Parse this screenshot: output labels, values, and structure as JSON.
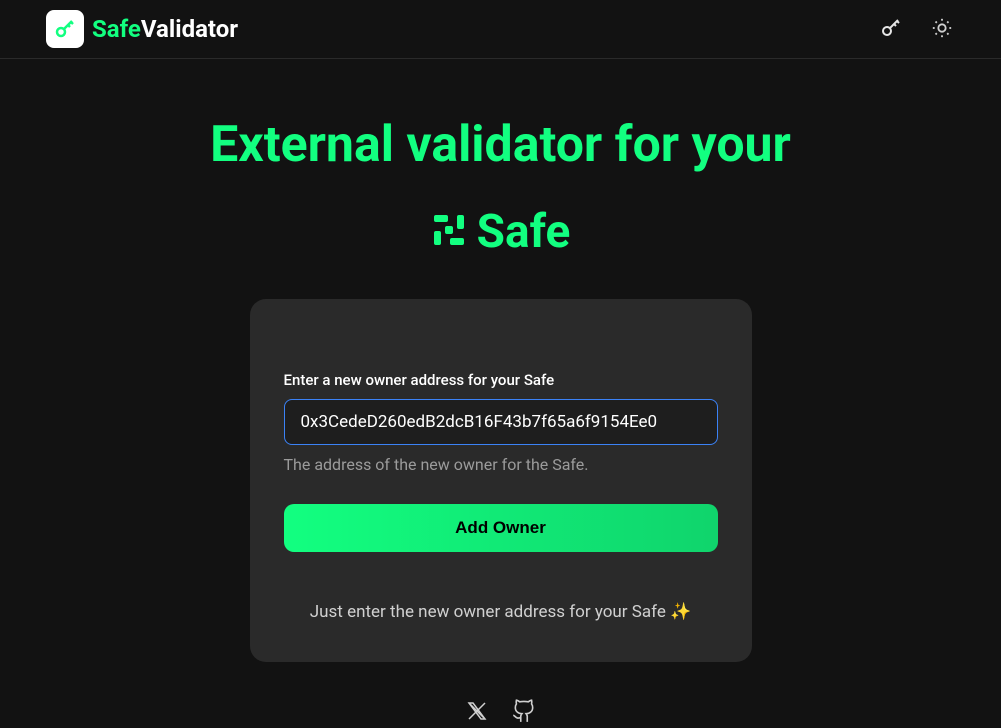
{
  "navbar": {
    "brand_part1": "Safe",
    "brand_part2": "Validator"
  },
  "hero": {
    "title": "External validator for your",
    "subtitle": "Safe"
  },
  "form": {
    "label": "Enter a new owner address for your Safe",
    "value": "0x3CedeD260edB2dcB16F43b7f65a6f9154Ee0",
    "hint": "The address of the new owner for the Safe.",
    "submit_label": "Add Owner"
  },
  "help": {
    "text": "Just enter the new owner address for your Safe ✨"
  }
}
